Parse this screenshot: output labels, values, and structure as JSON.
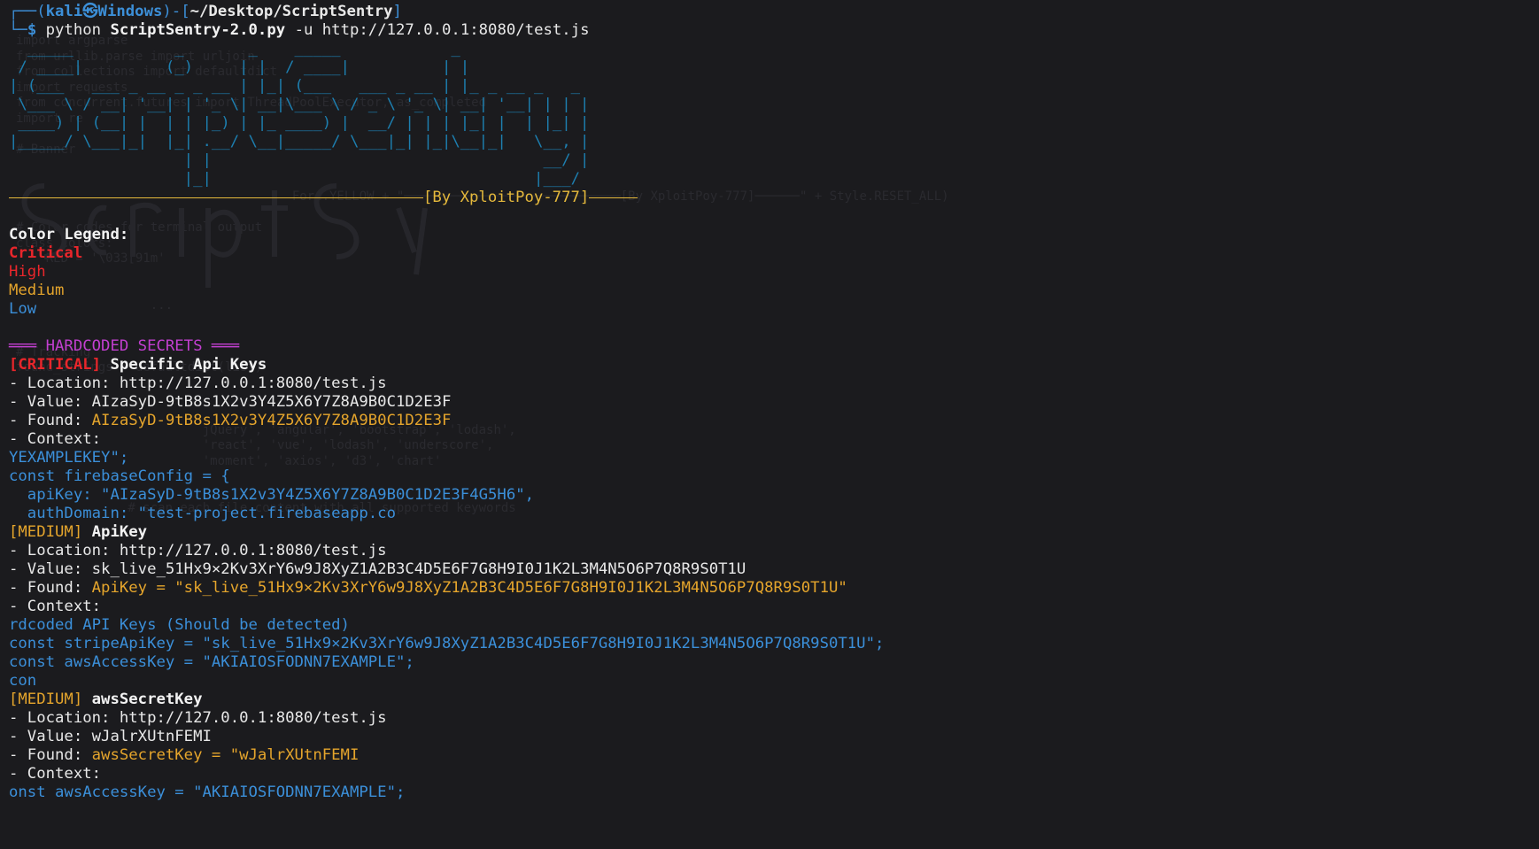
{
  "prompt": {
    "user": "kali",
    "separator": "㉿",
    "host": "Windows",
    "path": "~/Desktop/ScriptSentry",
    "symbol": "$",
    "command": "python",
    "script": "ScriptSentry-2.0.py",
    "args": "-u http://127.0.0.1:8080/test.js"
  },
  "banner": {
    "art": [
      "  _____           _       _    _____            _              ",
      " / ____|         (_)     | |  / ____|          | |             ",
      "| (___   ___ _ __ _ _ __ | |_| (___   ___ _ __ | |_ _ __ _   _ ",
      " \\___ \\ / __| '__| | '_ \\| __|\\___ \\ / _ \\ '_ \\| __| '__| | | |",
      " ____) | (__| |  | | |_) | |_ ____) |  __/ | | | |_| |  | |_| |",
      "|_____/ \\___|_|  |_| .__/ \\__|_____/ \\___|_| |_|\\__|_|   \\__, |",
      "                   | |                                    __/ |",
      "                   |_|                                   |___/ "
    ],
    "credit": "[By XploitPoy-777]"
  },
  "legend": {
    "title": "Color Legend:",
    "critical": "Critical",
    "high": "High",
    "medium": "Medium",
    "low": "Low"
  },
  "section": {
    "title": "═══ HARDCODED SECRETS ═══"
  },
  "labels": {
    "location": "- Location:",
    "value": "- Value:",
    "found": "- Found:",
    "context": "- Context:"
  },
  "findings": [
    {
      "severity": "[CRITICAL]",
      "name": "Specific Api Keys",
      "location": "http://127.0.0.1:8080/test.js",
      "value": "AIzaSyD-9tB8s1X2v3Y4Z5X6Y7Z8A9B0C1D2E3F",
      "found": "AIzaSyD-9tB8s1X2v3Y4Z5X6Y7Z8A9B0C1D2E3F",
      "context": [
        "YEXAMPLEKEY\";",
        "const firebaseConfig = {",
        "  apiKey: \"AIzaSyD-9tB8s1X2v3Y4Z5X6Y7Z8A9B0C1D2E3F4G5H6\",",
        "  authDomain: \"test-project.firebaseapp.co"
      ]
    },
    {
      "severity": "[MEDIUM]",
      "name": "ApiKey",
      "location": "http://127.0.0.1:8080/test.js",
      "value": "sk_live_51Hx9×2Kv3XrY6w9J8XyZ1A2B3C4D5E6F7G8H9I0J1K2L3M4N5O6P7Q8R9S0T1U",
      "found": "ApiKey = \"sk_live_51Hx9×2Kv3XrY6w9J8XyZ1A2B3C4D5E6F7G8H9I0J1K2L3M4N5O6P7Q8R9S0T1U\"",
      "context": [
        "rdcoded API Keys (Should be detected)",
        "const stripeApiKey = \"sk_live_51Hx9×2Kv3XrY6w9J8XyZ1A2B3C4D5E6F7G8H9I0J1K2L3M4N5O6P7Q8R9S0T1U\";",
        "const awsAccessKey = \"AKIAIOSFODNN7EXAMPLE\";",
        "con"
      ]
    },
    {
      "severity": "[MEDIUM]",
      "name": "awsSecretKey",
      "location": "http://127.0.0.1:8080/test.js",
      "value": "wJalrXUtnFEMI",
      "found": "awsSecretKey = \"wJalrXUtnFEMI",
      "context": [
        "onst awsAccessKey = \"AKIAIOSFODNN7EXAMPLE\";"
      ]
    }
  ],
  "colors": {
    "background": "#1b1b1e",
    "critical": "#e8262b",
    "high": "#e8262b",
    "medium": "#e5a52c",
    "low": "#3b8fd9",
    "section": "#c23fd0",
    "banner": "#1d7fb0",
    "credit": "#e5b93c"
  }
}
